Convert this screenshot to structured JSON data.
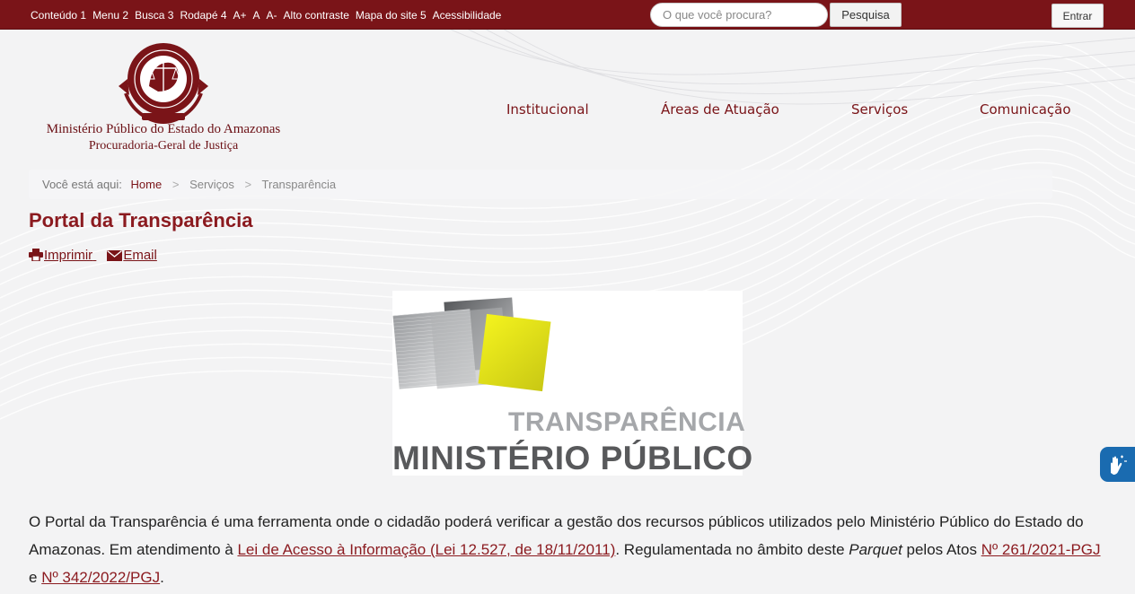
{
  "accessibility_bar": {
    "links": [
      "Conteúdo 1",
      "Menu 2",
      "Busca 3",
      "Rodapé 4",
      "A+",
      "A",
      "A-",
      "Alto contraste",
      "Mapa do site 5",
      "Acessibilidade"
    ]
  },
  "search": {
    "placeholder": "O que você procura?",
    "button_label": "Pesquisa"
  },
  "login": {
    "label": "Entrar"
  },
  "org": {
    "name": "Ministério Público do Estado do Amazonas",
    "subtitle": "Procuradoria-Geral de Justiça"
  },
  "nav": {
    "items": [
      "Institucional",
      "Áreas de Atuação",
      "Serviços",
      "Comunicação"
    ]
  },
  "breadcrumb": {
    "label": "Você está aqui:",
    "home": "Home",
    "section": "Serviços",
    "current": "Transparência"
  },
  "page": {
    "title": "Portal da Transparência"
  },
  "tools": {
    "print_label": "Imprimir",
    "email_label": "Email"
  },
  "banner": {
    "line1": "TRANSPARÊNCIA",
    "line2": "MINISTÉRIO PÚBLICO"
  },
  "body": {
    "part1": "O Portal da Transparência é uma ferramenta onde o cidadão poderá verificar a gestão dos recursos públicos utilizados pelo Ministério Público do Estado do Amazonas. Em atendimento à ",
    "lai_link": "Lei de Acesso à Informação (Lei 12.527, de 18/11/2011)",
    "part2": ". Regulamentada no âmbito deste ",
    "parquet": "Parquet",
    "part3": " pelos Atos ",
    "ato1": "Nº 261/2021-PGJ",
    "part4": " e ",
    "ato2": "Nº 342/2022/PGJ",
    "part5": "."
  },
  "colors": {
    "brand": "#7a1418",
    "title": "#8b1a1f",
    "vlibras": "#1a6bb0",
    "banner_yellow": "#e6e620"
  },
  "icons": [
    "printer-icon",
    "envelope-icon",
    "vlibras-hands-icon",
    "mpam-seal-logo"
  ]
}
